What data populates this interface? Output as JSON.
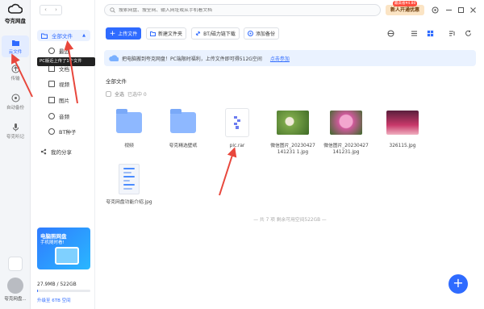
{
  "app": {
    "logo_text": "夸克网盘"
  },
  "rail": {
    "items": [
      {
        "label": "云文件",
        "icon": "folder-icon",
        "active": true
      },
      {
        "label": "传输",
        "icon": "transfer-icon"
      },
      {
        "label": "自动备份",
        "icon": "backup-icon"
      },
      {
        "label": "夸克听记",
        "icon": "microphone-icon"
      }
    ],
    "user_name": "夸克网盘..."
  },
  "sidebar": {
    "back": "‹",
    "forward": "›",
    "all_files": "全部文件",
    "sub_items": [
      "最近",
      "文档",
      "视频",
      "图片",
      "音频",
      "BT种子"
    ],
    "share": "我的分享",
    "tooltip": "PC版近上传了1个文件",
    "promo": {
      "title": "电脑照网盘",
      "subtitle": "手机随时看!"
    },
    "storage": "27.9MB / 522GB",
    "storage_used_fraction": 0.01,
    "upgrade": "升级至 6TB 空间"
  },
  "topbar": {
    "search_placeholder": "搜索网盘、搜全网、输入网址或从手机看文档",
    "vip_label": "新人开通优惠",
    "vip_badge": "最高省¥4.80"
  },
  "toolbar": {
    "upload": "上传文件",
    "new_folder": "新建文件夹",
    "bt_download": "BT/磁力链下载",
    "add_backup": "添加备份"
  },
  "banner": {
    "text": "把电脑搬到夸克网盘！PC端限时福利，上传文件即可得512G空间",
    "link": "点击参加"
  },
  "content": {
    "section_title": "全部文件",
    "select_all": "全选",
    "selected_count": "已选中 0",
    "files": [
      {
        "name": "视频",
        "kind": "folder"
      },
      {
        "name": "夸克精选壁纸",
        "kind": "folder"
      },
      {
        "name": "pic.rar",
        "kind": "rar"
      },
      {
        "name": "微信图片_20230427141231 1.jpg",
        "kind": "photo",
        "color": "#5f8f3a"
      },
      {
        "name": "微信图片_20230427141231.jpg",
        "kind": "photo",
        "color": "#c24c8a"
      },
      {
        "name": "326115.jpg",
        "kind": "photo",
        "color": "#b03060"
      },
      {
        "name": "夸克网盘功能介绍.jpg",
        "kind": "doc"
      }
    ],
    "footer": "— 共 7 项 剩余可用空间522GB —"
  },
  "colors": {
    "accent": "#2f6bff",
    "arrow": "#e8473c"
  }
}
